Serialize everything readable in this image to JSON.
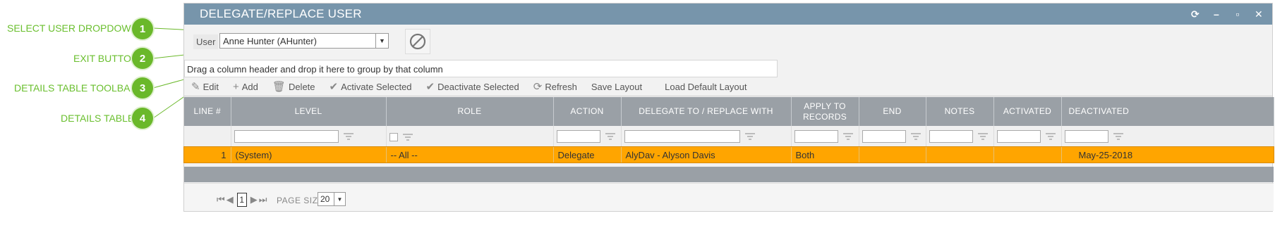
{
  "callouts": [
    {
      "num": "1",
      "label": "SELECT USER DROPDOWN"
    },
    {
      "num": "2",
      "label": "EXIT BUTTON"
    },
    {
      "num": "3",
      "label": "DETAILS TABLE TOOLBAR"
    },
    {
      "num": "4",
      "label": "DETAILS TABLE"
    }
  ],
  "window": {
    "title": "DELEGATE/REPLACE USER",
    "title_icons": [
      "refresh-icon",
      "minimize-icon",
      "maximize-icon",
      "close-icon"
    ]
  },
  "user": {
    "label": "User",
    "selected": "Anne Hunter (AHunter)"
  },
  "group_bar": "Drag a column header and drop it here to group by that column",
  "toolbar": {
    "edit": "Edit",
    "add": "Add",
    "delete": "Delete",
    "activate": "Activate Selected",
    "deactivate": "Deactivate Selected",
    "refresh": "Refresh",
    "save_layout": "Save Layout",
    "load_default": "Load Default Layout"
  },
  "table": {
    "columns": [
      "LINE #",
      "LEVEL",
      "ROLE",
      "ACTION",
      "DELEGATE TO / REPLACE WITH",
      "APPLY TO RECORDS",
      "END",
      "NOTES",
      "ACTIVATED",
      "DEACTIVATED"
    ],
    "rows": [
      {
        "line": "1",
        "level": "(System)",
        "role": "-- All --",
        "action": "Delegate",
        "delegate": "AlyDav - Alyson Davis",
        "apply": "Both",
        "end": "",
        "notes": "",
        "activated": "",
        "deactivated": "May-25-2018"
      }
    ]
  },
  "pager": {
    "page": "1",
    "page_size_label": "PAGE SIZE",
    "page_size": "20"
  },
  "colors": {
    "titlebar": "#7795ab",
    "header": "#9aa0a6",
    "selected_row": "#ffa500",
    "callout_green": "#6ab82a"
  }
}
